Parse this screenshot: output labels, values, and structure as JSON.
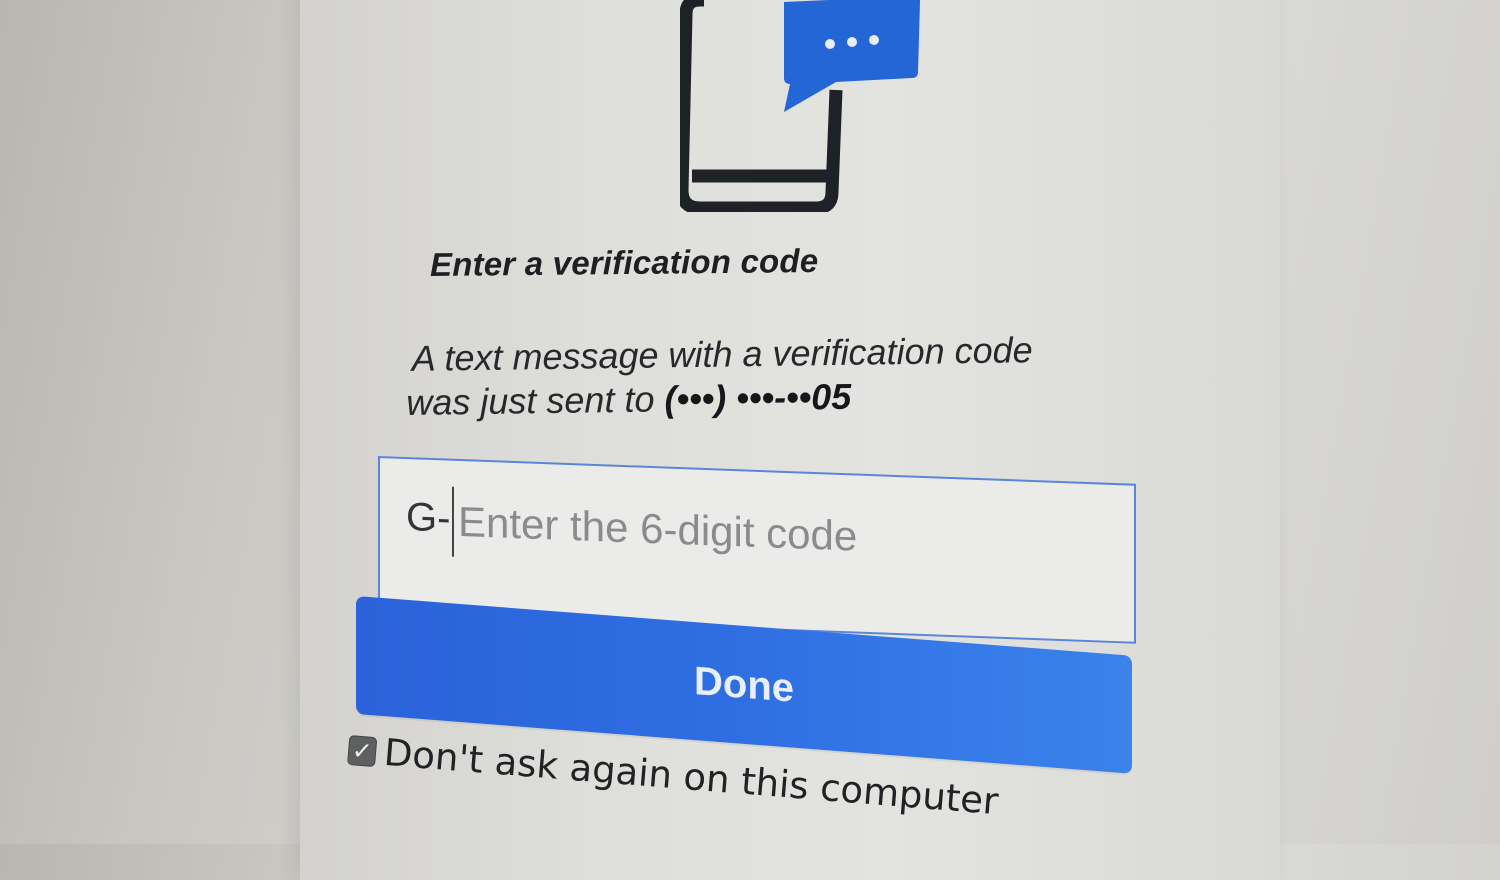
{
  "header": {
    "illustration": "phone-with-message-bubble-icon",
    "title": "Enter a verification code"
  },
  "message": {
    "line1": "A text message with a verification code",
    "line2_prefix": "was just sent to ",
    "phone_number": "(•••) •••-••05"
  },
  "code_field": {
    "prefix": "G-",
    "value": "",
    "placeholder": "Enter the 6-digit code"
  },
  "actions": {
    "done_label": "Done"
  },
  "remember": {
    "checked": true,
    "check_glyph": "✓",
    "label": "Don't ask again on this computer"
  },
  "colors": {
    "accent": "#2f6fe2",
    "field_border": "#5b86d8",
    "icon_dark": "#1e2126",
    "bubble_blue": "#2466d6"
  }
}
